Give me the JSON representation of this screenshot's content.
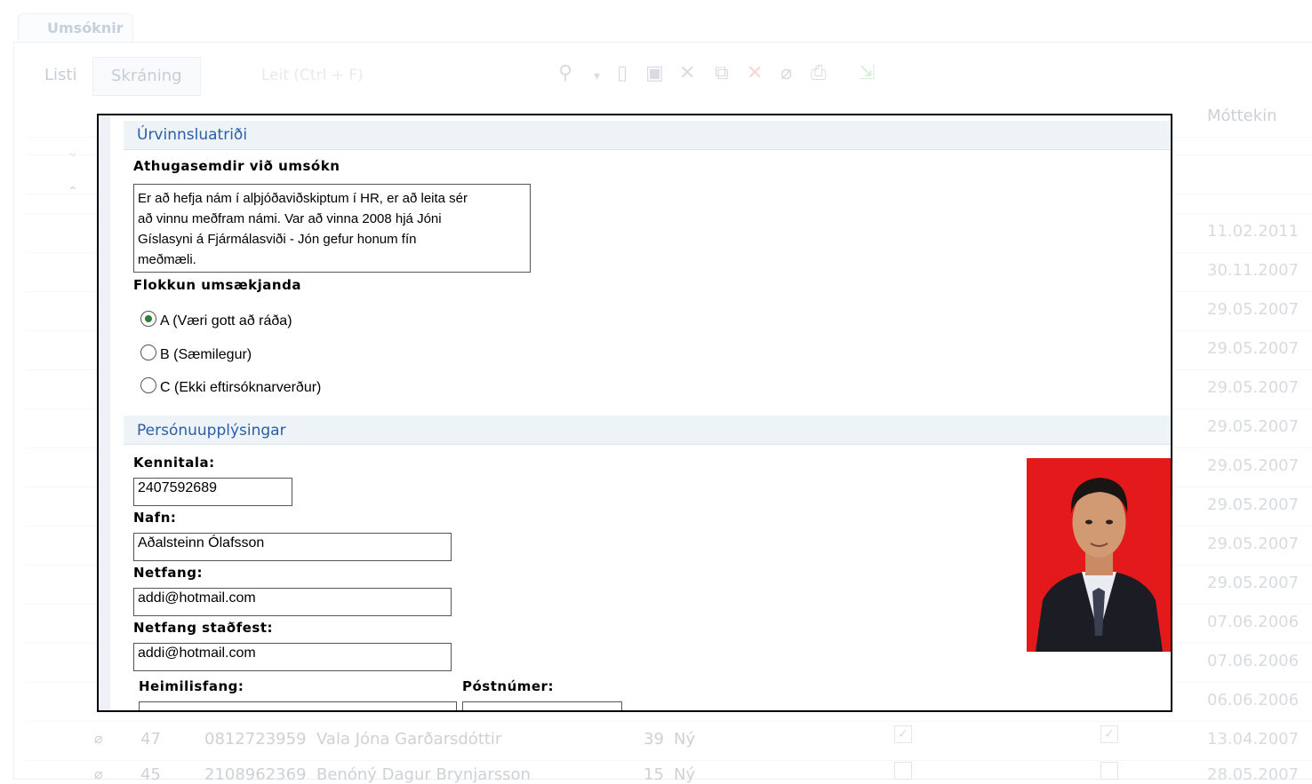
{
  "window": {
    "tab_title": "Umsóknir"
  },
  "tabs": [
    {
      "label": "Listi"
    },
    {
      "label": "Skráning"
    }
  ],
  "search": {
    "placeholder": "Leit (Ctrl + F)"
  },
  "grid": {
    "columns": [
      "Móttekin"
    ],
    "dates": [
      "11.02.2011",
      "30.11.2007",
      "29.05.2007",
      "29.05.2007",
      "29.05.2007",
      "29.05.2007",
      "29.05.2007",
      "29.05.2007",
      "29.05.2007",
      "29.05.2007",
      "07.06.2006",
      "07.06.2006",
      "06.06.2006",
      "13.04.2007",
      "28.05.2007"
    ],
    "bottom_rows": [
      {
        "nr": "47",
        "kennitala": "0812723959",
        "nafn": "Vala Jóna Garðarsdóttir",
        "aldur": "39",
        "stada": "Ný"
      },
      {
        "nr": "45",
        "kennitala": "2108962369",
        "nafn": "Benóný Dagur Brynjarsson",
        "aldur": "15",
        "stada": "Ný"
      }
    ]
  },
  "popup": {
    "section_processing": "Úrvinnsluatriði",
    "comments_label": "Athugasemdir við umsókn",
    "comments_lines": [
      "Er að hefja nám í alþjóðaviðskiptum í HR, er að leita sér",
      "að vinnu meðfram námi.  Var að vinna 2008 hjá Jóni",
      "Gíslasyni á Fjármálasviði - Jón gefur honum fín",
      "meðmæli."
    ],
    "classification_label": "Flokkun umsækjanda",
    "options": [
      {
        "label": "A (Væri gott að ráða)",
        "selected": true
      },
      {
        "label": "B (Sæmilegur)",
        "selected": false
      },
      {
        "label": "C (Ekki eftirsóknarverður)",
        "selected": false
      }
    ],
    "section_personal": "Persónuupplýsingar",
    "kennitala_label": "Kennitala:",
    "kennitala_value": "2407592689",
    "nafn_label": "Nafn:",
    "nafn_value": "Aðalsteinn Ólafsson",
    "netfang_label": "Netfang:",
    "netfang_value": "addi@hotmail.com",
    "netfang_confirm_label": "Netfang staðfest:",
    "netfang_confirm_value": "addi@hotmail.com",
    "heimilisfang_label": "Heimilisfang:",
    "postnumer_label": "Póstnúmer:"
  }
}
